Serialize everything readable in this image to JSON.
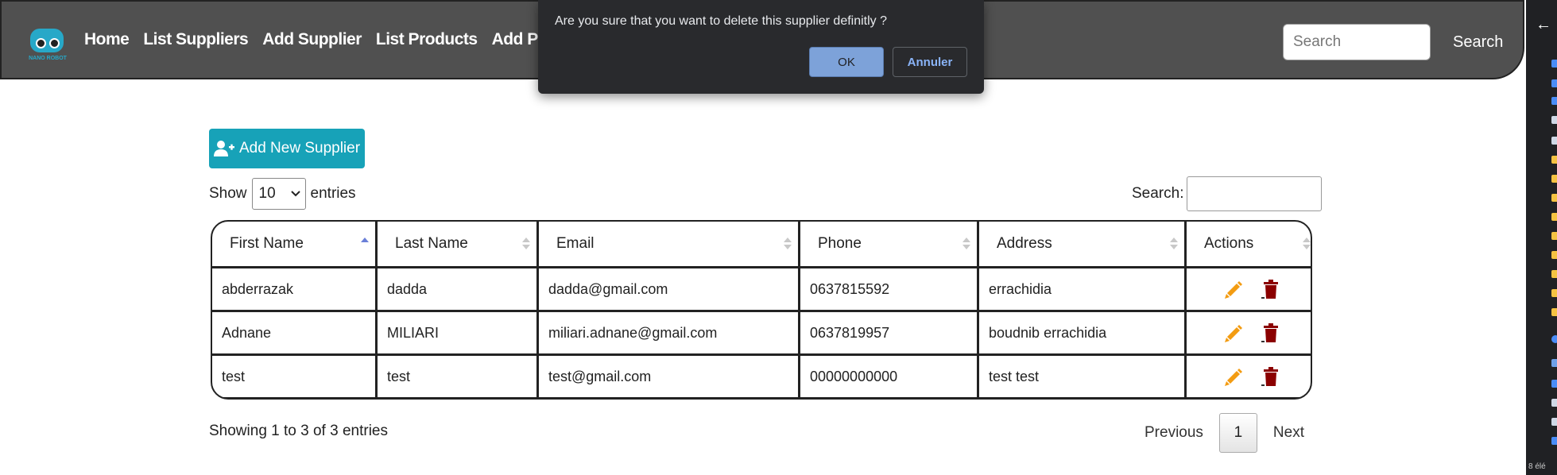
{
  "navbar": {
    "logo_text": "NANO ROBOT",
    "links": [
      "Home",
      "List Suppliers",
      "Add Supplier",
      "List Products",
      "Add Product"
    ],
    "search_placeholder": "Search",
    "search_button": "Search"
  },
  "dialog": {
    "message": "Are you sure that you want to delete this supplier definitly ?",
    "ok_label": "OK",
    "cancel_label": "Annuler"
  },
  "add_button": {
    "label": "Add New Supplier",
    "icon": "user-plus-icon"
  },
  "table_controls": {
    "show_label": "Show",
    "entries_value": "10",
    "entries_label": "entries",
    "search_label": "Search:"
  },
  "table": {
    "columns": [
      "First Name",
      "Last Name",
      "Email",
      "Phone",
      "Address",
      "Actions"
    ],
    "sorted_column": "First Name",
    "rows": [
      [
        "abderrazak",
        "dadda",
        "dadda@gmail.com",
        "0637815592",
        "errachidia"
      ],
      [
        "Adnane",
        "MILIARI",
        "miliari.adnane@gmail.com",
        "0637819957",
        "boudnib errachidia"
      ],
      [
        "test",
        "test",
        "test@gmail.com",
        "00000000000",
        "test test"
      ]
    ],
    "action_icons": [
      "pencil-icon",
      "trash-icon"
    ]
  },
  "footer": {
    "info": "Showing 1 to 3 of 3 entries",
    "previous": "Previous",
    "page": "1",
    "next": "Next"
  },
  "sidepanel": {
    "back_icon": "arrow-left-icon",
    "footer_text": "8 élé"
  },
  "colors": {
    "navbar_bg": "#505050",
    "accent_teal": "#17a2b8",
    "edit_orange": "#f39c12",
    "delete_red": "#8b0000",
    "dialog_bg": "#292a2d",
    "ok_button": "#7da2d9"
  }
}
